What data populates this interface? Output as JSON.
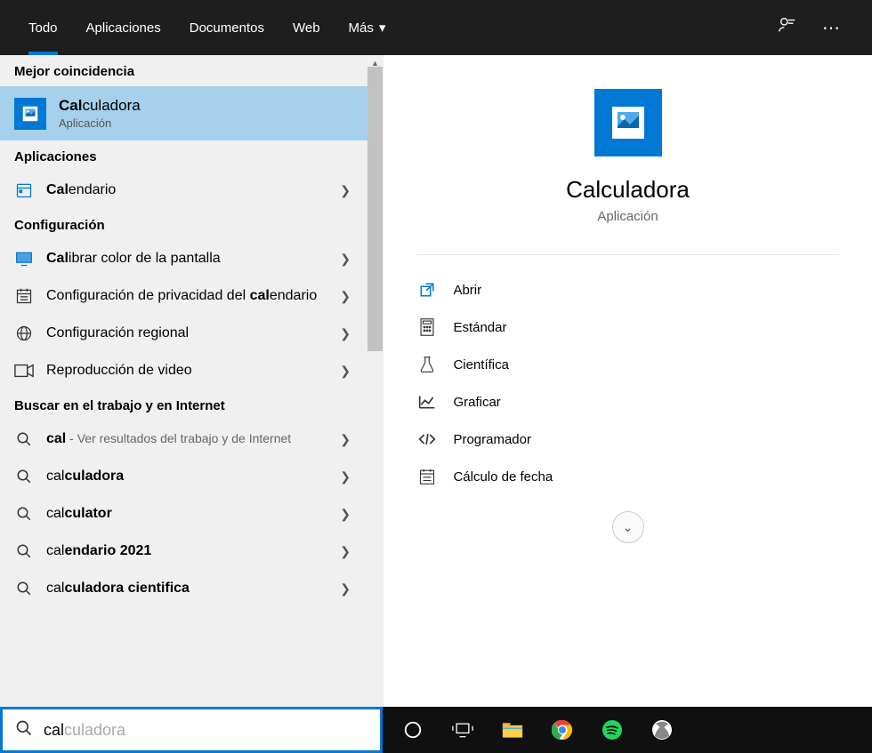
{
  "tabs": {
    "all": "Todo",
    "apps": "Aplicaciones",
    "docs": "Documentos",
    "web": "Web",
    "more": "Más"
  },
  "sections": {
    "best": "Mejor coincidencia",
    "apps": "Aplicaciones",
    "settings": "Configuración",
    "search": "Buscar en el trabajo y en Internet"
  },
  "bestMatch": {
    "title": "Calculadora",
    "bold": "Cal",
    "rest": "culadora",
    "subtitle": "Aplicación"
  },
  "appsList": [
    {
      "bold": "Cal",
      "rest": "endario"
    }
  ],
  "settingsList": [
    {
      "bold": "Cal",
      "rest": "ibrar color de la pantalla",
      "icon": "monitor"
    },
    {
      "pre": "Configuración de privacidad del ",
      "bold": "cal",
      "rest": "endario",
      "icon": "calendar"
    },
    {
      "pre": "Configuración regional",
      "bold": "",
      "rest": "",
      "icon": "globe"
    },
    {
      "pre": "Reproducción de video",
      "bold": "",
      "rest": "",
      "icon": "video"
    }
  ],
  "webList": [
    {
      "bold": "cal",
      "sub": " - Ver resultados del trabajo y de Internet"
    },
    {
      "pre": "cal",
      "bold": "culadora"
    },
    {
      "pre": "cal",
      "bold": "culator"
    },
    {
      "pre": "cal",
      "bold": "endario 2021"
    },
    {
      "pre": "cal",
      "bold": "culadora cientifica"
    }
  ],
  "detail": {
    "title": "Calculadora",
    "subtitle": "Aplicación",
    "actions": [
      {
        "icon": "open",
        "label": "Abrir"
      },
      {
        "icon": "calc",
        "label": "Estándar"
      },
      {
        "icon": "flask",
        "label": "Científica"
      },
      {
        "icon": "graph",
        "label": "Graficar"
      },
      {
        "icon": "code",
        "label": "Programador"
      },
      {
        "icon": "date",
        "label": "Cálculo de fecha"
      }
    ]
  },
  "search": {
    "typed": "cal",
    "hint": "culadora"
  }
}
